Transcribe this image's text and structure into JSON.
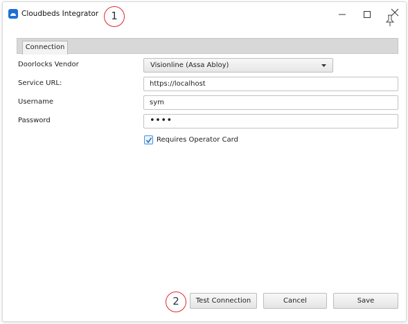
{
  "window": {
    "title": "Cloudbeds Integrator"
  },
  "callouts": [
    "1",
    "2"
  ],
  "tabs": [
    {
      "label": "Connection"
    }
  ],
  "form": {
    "vendor_label": "Doorlocks Vendor",
    "vendor_value": "Visionline (Assa Abloy)",
    "url_label": "Service URL:",
    "url_value": "https://localhost",
    "username_label": "Username",
    "username_value": "sym",
    "password_label": "Password",
    "password_value": "••••",
    "operator_card_label": "Requires Operator Card",
    "operator_card_checked": true
  },
  "buttons": {
    "test": "Test Connection",
    "cancel": "Cancel",
    "save": "Save"
  },
  "colors": {
    "accent": "#1f6fd6",
    "callout": "#e0262b",
    "check": "#4a90d9"
  }
}
